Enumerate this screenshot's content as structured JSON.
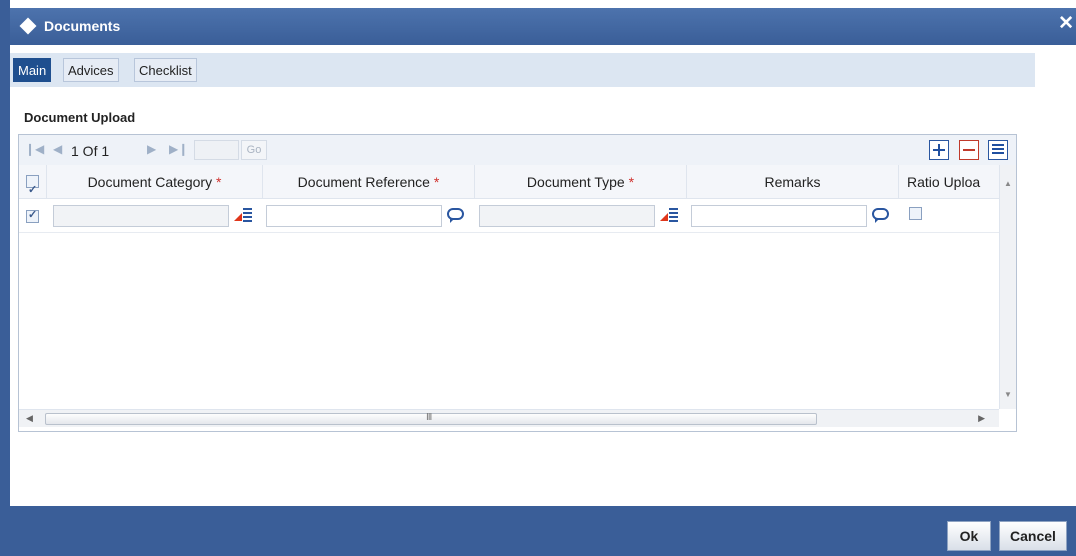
{
  "window": {
    "title": "Documents"
  },
  "tabs": [
    {
      "label": "Main",
      "active": true
    },
    {
      "label": "Advices",
      "active": false
    },
    {
      "label": "Checklist",
      "active": false
    }
  ],
  "section": {
    "title": "Document Upload"
  },
  "pager": {
    "text": "1 Of 1",
    "go_label": "Go",
    "page_value": ""
  },
  "columns": [
    {
      "label": "Document Category",
      "required": true
    },
    {
      "label": "Document Reference",
      "required": true
    },
    {
      "label": "Document Type",
      "required": true
    },
    {
      "label": "Remarks",
      "required": false
    },
    {
      "label": "Ratio Uploa",
      "required": false
    }
  ],
  "required_marker": "*",
  "rows": [
    {
      "selected": true,
      "document_category": "",
      "document_reference": "",
      "document_type": "",
      "remarks": "",
      "ratio_upload": false
    }
  ],
  "header_select_all": true,
  "scrollbar": {
    "grip": "III"
  },
  "buttons": {
    "ok": "Ok",
    "cancel": "Cancel"
  },
  "colors": {
    "titlebar": "#3a5e98",
    "active_tab": "#1f4f8f",
    "required": "#d0312d"
  },
  "icons": [
    "diamond-icon",
    "close-icon",
    "first-page-icon",
    "prev-page-icon",
    "next-page-icon",
    "last-page-icon",
    "add-row-icon",
    "delete-row-icon",
    "single-view-icon",
    "lov-icon",
    "remarks-icon"
  ]
}
